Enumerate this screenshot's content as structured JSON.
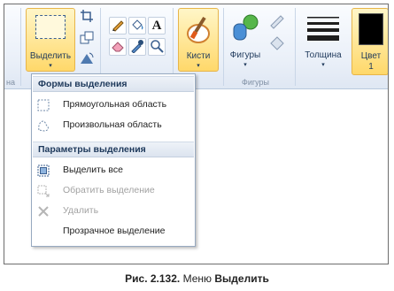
{
  "ribbon": {
    "select_button": {
      "label": "Выделить",
      "arrow": "▾"
    },
    "text_tool_glyph": "A",
    "brushes_button": {
      "label": "Кисти",
      "arrow": "▾"
    },
    "shapes_button": {
      "label": "Фигуры",
      "arrow": "▾"
    },
    "thickness_button": {
      "label": "Толщина",
      "arrow": "▾"
    },
    "color1_button": {
      "label": "Цвет",
      "sub": "1",
      "color": "#000000"
    },
    "groups": {
      "left_partial": "на",
      "shapes": "Фигуры"
    },
    "accent_colors": {
      "active_top": "#fff6c8",
      "active_bottom": "#ffd86a",
      "active_border": "#e7b54a"
    }
  },
  "menu": {
    "sections": [
      {
        "header": "Формы выделения",
        "items": [
          {
            "label": "Прямоугольная область",
            "icon": "rect-select-icon",
            "enabled": true
          },
          {
            "label": "Произвольная область",
            "icon": "freeform-select-icon",
            "enabled": true
          }
        ]
      },
      {
        "header": "Параметры выделения",
        "items": [
          {
            "label": "Выделить все",
            "icon": "select-all-icon",
            "enabled": true
          },
          {
            "label": "Обратить выделение",
            "icon": "invert-selection-icon",
            "enabled": false
          },
          {
            "label": "Удалить",
            "icon": "delete-icon",
            "enabled": false
          },
          {
            "label": "Прозрачное выделение",
            "icon": "",
            "enabled": true
          }
        ]
      }
    ]
  },
  "caption": {
    "prefix": "Рис. 2.132.",
    "middle": " Меню ",
    "bold": "Выделить"
  }
}
